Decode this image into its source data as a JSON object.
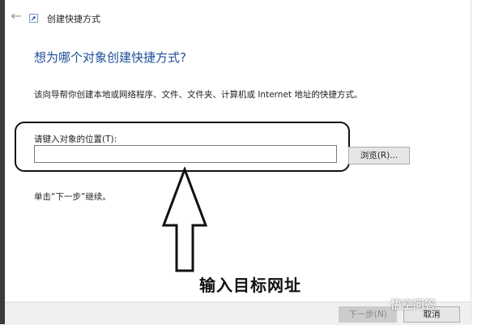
{
  "window": {
    "title": "创建快捷方式"
  },
  "wizard": {
    "heading": "想为哪个对象创建快捷方式?",
    "description": "该向导帮你创建本地或网络程序、文件、文件夹、计算机或 Internet 地址的快捷方式。",
    "location_label": "请键入对象的位置(T):",
    "location_value": "",
    "browse_label": "浏览(R)...",
    "hint": "单击“下一步”继续。"
  },
  "footer": {
    "next_label": "下一步(N)",
    "cancel_label": "取消"
  },
  "annotation": {
    "caption": "输入目标网址"
  },
  "watermark": {
    "text": "悟空问答"
  },
  "colors": {
    "heading": "#1f4e9a",
    "annotation": "#111111",
    "disabled_button": "#cccccc"
  },
  "icons": {
    "back": "back-arrow-icon",
    "app": "shortcut-app-icon",
    "annotation_arrow": "up-arrow-icon"
  }
}
